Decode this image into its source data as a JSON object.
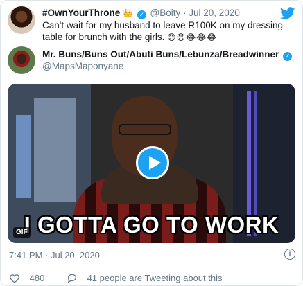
{
  "quoted": {
    "name": "#OwnYourThrone",
    "name_emoji": "👑",
    "handle": "@Boity",
    "sep": "·",
    "date": "Jul 20, 2020",
    "text": "Can't wait for my husband to leave R100K on my dressing table for brunch with the girls.",
    "emojis": "😊😊😂😂😂"
  },
  "author": {
    "name": "Mr. Buns/Buns Out/Abuti Buns/Lebunza/Breadwinner",
    "handle": "@MapsMaponyane"
  },
  "media": {
    "caption": "I GOTTA GO TO WORK",
    "badge": "GIF"
  },
  "footer": {
    "timestamp": "7:41 PM · Jul 20, 2020",
    "likes": "480",
    "comments": "41 people are Tweeting about this"
  },
  "colors": {
    "accent": "#1da1f2",
    "muted": "#657786"
  },
  "icons": [
    "twitter-bird-icon",
    "verified-icon",
    "play-icon",
    "info-icon",
    "heart-icon",
    "comment-icon"
  ]
}
